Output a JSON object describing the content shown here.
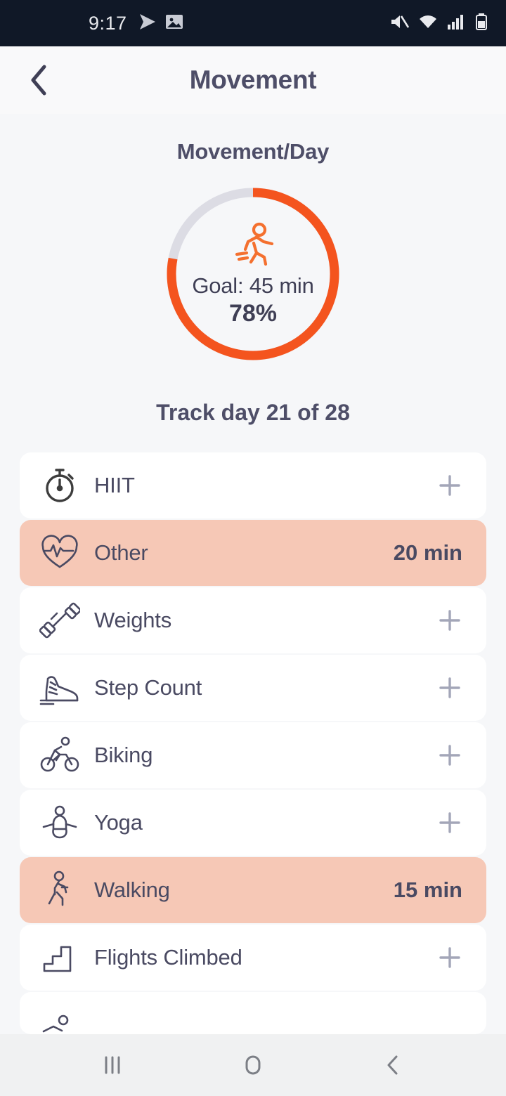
{
  "status_bar": {
    "time": "9:17",
    "left_icons": [
      "send-icon",
      "image-icon"
    ],
    "right_icons": [
      "mute-icon",
      "wifi-icon",
      "signal-icon",
      "battery-icon"
    ],
    "background_color": "#101827"
  },
  "app_bar": {
    "back_label": "back-chevron",
    "title": "Movement"
  },
  "movement": {
    "section_title": "Movement/Day",
    "goal_text": "Goal: 45 min",
    "percent_text": "78%",
    "percent_value": 78,
    "ring_icon": "running-person-icon",
    "ring_fill_color": "#f4541e",
    "ring_track_color": "#dcdce4",
    "track_day": "Track day 21 of 28"
  },
  "activities": [
    {
      "icon": "stopwatch-icon",
      "label": "HIIT",
      "value": "",
      "action": "+",
      "highlighted": false
    },
    {
      "icon": "heart-pulse-icon",
      "label": "Other",
      "value": "20 min",
      "action": "",
      "highlighted": true
    },
    {
      "icon": "dumbbell-icon",
      "label": "Weights",
      "value": "",
      "action": "+",
      "highlighted": false
    },
    {
      "icon": "sneaker-icon",
      "label": "Step Count",
      "value": "",
      "action": "+",
      "highlighted": false
    },
    {
      "icon": "bicycle-icon",
      "label": "Biking",
      "value": "",
      "action": "+",
      "highlighted": false
    },
    {
      "icon": "yoga-icon",
      "label": "Yoga",
      "value": "",
      "action": "+",
      "highlighted": false
    },
    {
      "icon": "walking-person-icon",
      "label": "Walking",
      "value": "15 min",
      "action": "",
      "highlighted": true
    },
    {
      "icon": "stairs-icon",
      "label": "Flights Climbed",
      "value": "",
      "action": "+",
      "highlighted": false
    }
  ],
  "nav_bar": {
    "recents_label": "recents-icon",
    "home_label": "home-icon",
    "back_label": "back-icon",
    "background_color": "#f0f1f2"
  },
  "colors": {
    "accent": "#f4541e",
    "highlight": "#f6c8b6",
    "text": "#4a4a62",
    "plus": "#a3a6b8",
    "page_bg": "#f6f7f9"
  }
}
